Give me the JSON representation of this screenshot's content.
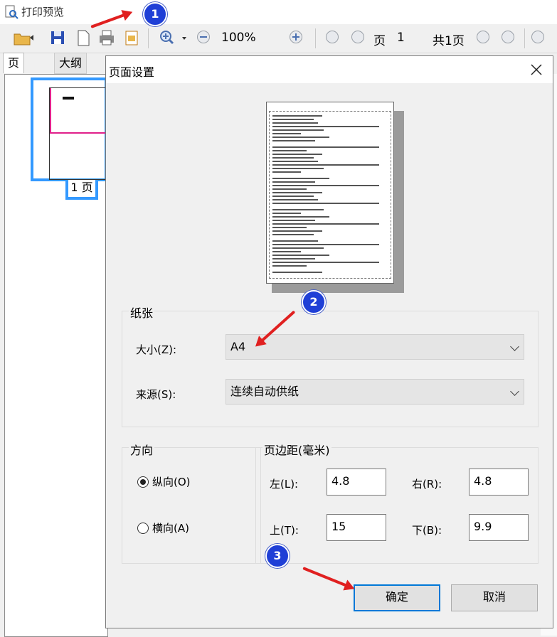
{
  "window": {
    "title": "打印预览"
  },
  "toolbar": {
    "zoom": "100%",
    "page_label": "页",
    "page_value": "1",
    "total_pages": "共1页"
  },
  "left_panel": {
    "tab_page": "页",
    "tab_outline": "大纲",
    "thumb_label": "1 页"
  },
  "dialog": {
    "title": "页面设置",
    "paper": {
      "group_label": "纸张",
      "size_label": "大小(Z):",
      "size_value": "A4",
      "source_label": "来源(S):",
      "source_value": "连续自动供纸"
    },
    "orientation": {
      "group_label": "方向",
      "portrait": "纵向(O)",
      "landscape": "横向(A)",
      "selected": "portrait"
    },
    "margins": {
      "group_label": "页边距(毫米)",
      "left_label": "左(L):",
      "left_value": "4.8",
      "right_label": "右(R):",
      "right_value": "4.8",
      "top_label": "上(T):",
      "top_value": "15",
      "bottom_label": "下(B):",
      "bottom_value": "9.9"
    },
    "ok": "确定",
    "cancel": "取消"
  },
  "markers": [
    "1",
    "2",
    "3"
  ],
  "colors": {
    "accent": "#0078d7",
    "marker": "#1f3fd6",
    "arrow": "#e02020",
    "thumb_border": "#3399ff"
  }
}
